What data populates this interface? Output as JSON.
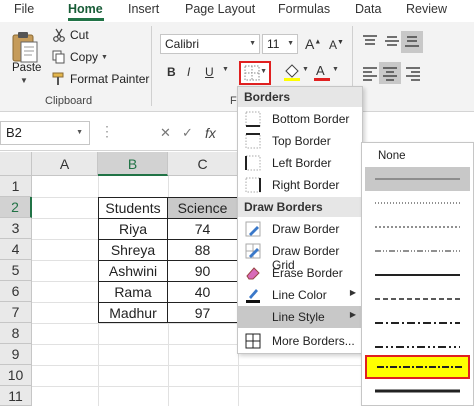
{
  "ribbon_tabs": [
    "File",
    "Home",
    "Insert",
    "Page Layout",
    "Formulas",
    "Data",
    "Review"
  ],
  "active_tab": "Home",
  "clipboard": {
    "paste_label": "Paste",
    "cut_label": "Cut",
    "copy_label": "Copy",
    "format_painter_label": "Format Painter",
    "group_label": "Clipboard"
  },
  "font": {
    "name": "Calibri",
    "size": "11",
    "bold": "B",
    "italic": "I",
    "underline": "U",
    "group_label_partial": "Fo"
  },
  "formula_bar": {
    "name_box": "B2",
    "fx": "fx",
    "cancel": "✕",
    "enter": "✓"
  },
  "grid": {
    "columns": [
      "A",
      "B",
      "C"
    ],
    "rows": [
      "1",
      "2",
      "3",
      "4",
      "5",
      "6",
      "7",
      "8",
      "9",
      "10",
      "11"
    ],
    "selected_column": "B",
    "selected_row": "2"
  },
  "table": {
    "headers": [
      "Students",
      "Science"
    ],
    "rows": [
      [
        "Riya",
        "74"
      ],
      [
        "Shreya",
        "88"
      ],
      [
        "Ashwini",
        "90"
      ],
      [
        "Rama",
        "40"
      ],
      [
        "Madhur",
        "97"
      ]
    ]
  },
  "borders_menu": {
    "section_borders": "Borders",
    "bottom_border": "Bottom Border",
    "top_border": "Top Border",
    "left_border": "Left Border",
    "right_border": "Right Border",
    "section_draw": "Draw Borders",
    "draw_border": "Draw Border",
    "draw_border_grid": "Draw Border Grid",
    "erase_border": "Erase Border",
    "line_color": "Line Color",
    "line_style": "Line Style",
    "more_borders": "More Borders..."
  },
  "line_style_menu": {
    "none_label": "None",
    "styles": [
      "thin",
      "dotted-hair",
      "dotted",
      "dash-dot-dot",
      "dash-dot",
      "dashed",
      "medium",
      "medium-dash-dot-dot",
      "slanted-dash-dot",
      "medium-dashed",
      "thick",
      "double"
    ],
    "highlighted_style": "thin",
    "marked_style": "slanted-dash-dot"
  },
  "colors": {
    "excel_green": "#217346",
    "highlight_red": "#e02020",
    "highlight_yellow": "#ffff00",
    "selected_header_bg": "#c9c9c9"
  }
}
